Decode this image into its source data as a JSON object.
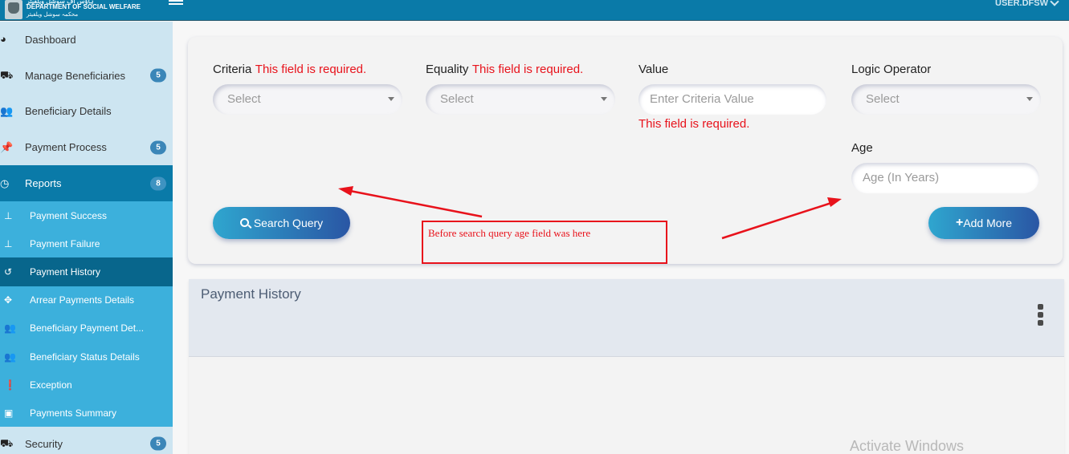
{
  "header": {
    "brand_top": "ہاؤس آف سوشل ویلفیئر",
    "brand_title": "DEPARTMENT OF SOCIAL WELFARE",
    "brand_subtitle": "محکمہ سوشل ویلفیئر",
    "user": "USER.DFSW",
    "logo_icon": "emblem-logo",
    "menu_icon": "hamburger-icon"
  },
  "sidebar": {
    "items": [
      {
        "label": "Dashboard",
        "icon": "tachometer-icon",
        "glyph": "◕"
      },
      {
        "label": "Manage Beneficiaries",
        "icon": "car-icon",
        "glyph": "⛟",
        "badge": "5"
      },
      {
        "label": "Beneficiary Details",
        "icon": "users-icon",
        "glyph": "👥"
      },
      {
        "label": "Payment Process",
        "icon": "thumbtack-icon",
        "glyph": "📌",
        "badge": "5"
      },
      {
        "label": "Reports",
        "icon": "clock-icon",
        "glyph": "◷",
        "badge": "8",
        "active": true
      }
    ],
    "sub_items": [
      {
        "label": "Payment Success",
        "icon": "thumbtack-icon",
        "glyph": "⊥"
      },
      {
        "label": "Payment Failure",
        "icon": "thumbtack-icon",
        "glyph": "⊥"
      },
      {
        "label": "Payment History",
        "icon": "history-icon",
        "glyph": "↺",
        "active": true
      },
      {
        "label": "Arrear Payments Details",
        "icon": "arrows-icon",
        "glyph": "✥"
      },
      {
        "label": "Beneficiary Payment Det...",
        "icon": "users-icon",
        "glyph": "👥"
      },
      {
        "label": "Beneficiary Status Details",
        "icon": "users-icon",
        "glyph": "👥"
      },
      {
        "label": "Exception",
        "icon": "exclamation-circle-icon",
        "glyph": "❗"
      },
      {
        "label": "Payments Summary",
        "icon": "money-bill-icon",
        "glyph": "▣"
      }
    ],
    "after_items": [
      {
        "label": "Security",
        "icon": "truck-icon",
        "glyph": "⛟",
        "badge": "5"
      }
    ]
  },
  "form": {
    "criteria": {
      "label": "Criteria",
      "error": "This field is required.",
      "placeholder": "Select"
    },
    "equality": {
      "label": "Equality",
      "error": "This field is required.",
      "placeholder": "Select"
    },
    "value": {
      "label": "Value",
      "placeholder": "Enter Criteria Value",
      "error": "This field is required."
    },
    "logic_operator": {
      "label": "Logic Operator",
      "placeholder": "Select"
    },
    "age": {
      "label": "Age",
      "placeholder": "Age (In Years)"
    },
    "search_button": "Search Query",
    "add_more_button": "Add More",
    "add_more_prefix": "+"
  },
  "annotation": {
    "text": "Before search query age field was here",
    "color": "#e8121b"
  },
  "history": {
    "title": "Payment History"
  },
  "watermark": "Activate Windows",
  "colors": {
    "topbar": "#0a7aa8",
    "sidebar_bg": "#cde5f1",
    "submenu_bg": "#3cb0dc",
    "submenu_active": "#08668c",
    "badge": "#3a86b8",
    "error": "#e8121b",
    "button_gradient_start": "#2fa6cf",
    "button_gradient_end": "#2a56a4"
  }
}
